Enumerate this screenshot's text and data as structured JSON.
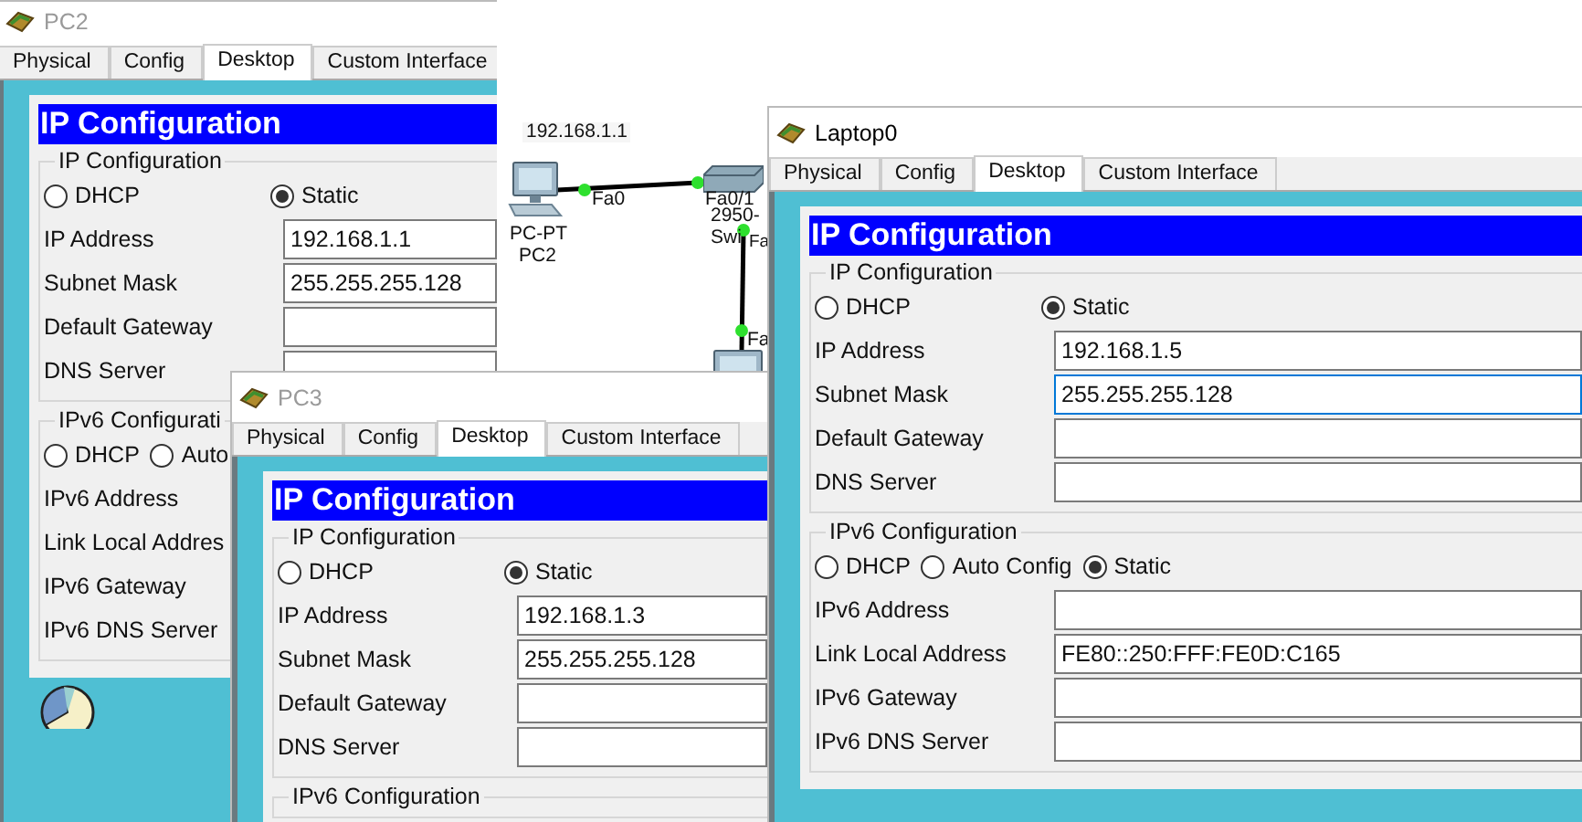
{
  "canvas": {
    "address_note": "192.168.1.1",
    "devices": [
      {
        "kind": "pc",
        "model": "PC-PT",
        "name": "PC2"
      },
      {
        "kind": "switch",
        "model": "2950-",
        "name": "Swi"
      },
      {
        "kind": "pc"
      }
    ],
    "port_labels": [
      "Fa0",
      "Fa0/1",
      "Fa",
      "Fa"
    ]
  },
  "windows": [
    {
      "title": "PC2",
      "active": false,
      "tabs": [
        {
          "label": "Physical",
          "selected": false
        },
        {
          "label": "Config",
          "selected": false
        },
        {
          "label": "Desktop",
          "selected": true
        },
        {
          "label": "Custom Interface",
          "selected": false
        }
      ],
      "heading": "IP Configuration",
      "ipv4": {
        "legend": "IP Configuration",
        "modes": [
          {
            "label": "DHCP",
            "selected": false
          },
          {
            "label": "Static",
            "selected": true
          }
        ],
        "fields": [
          {
            "label": "IP Address",
            "value": "192.168.1.1",
            "focused": false
          },
          {
            "label": "Subnet Mask",
            "value": "255.255.255.128",
            "focused": false
          },
          {
            "label": "Default Gateway",
            "focused": false
          },
          {
            "label": "DNS Server",
            "focused": false
          }
        ]
      },
      "ipv6": {
        "legend": "IPv6 Configurati",
        "modes": [
          {
            "label": "DHCP",
            "selected": false
          },
          {
            "label": "Auto",
            "selected": false
          }
        ],
        "fields": [
          {
            "label": "IPv6 Address"
          },
          {
            "label": "Link Local Addres"
          },
          {
            "label": "IPv6 Gateway"
          },
          {
            "label": "IPv6 DNS Server"
          }
        ]
      }
    },
    {
      "title": "PC3",
      "active": false,
      "tabs": [
        {
          "label": "Physical",
          "selected": false
        },
        {
          "label": "Config",
          "selected": false
        },
        {
          "label": "Desktop",
          "selected": true
        },
        {
          "label": "Custom Interface",
          "selected": false
        }
      ],
      "heading": "IP Configuration",
      "ipv4": {
        "legend": "IP Configuration",
        "modes": [
          {
            "label": "DHCP",
            "selected": false
          },
          {
            "label": "Static",
            "selected": true
          }
        ],
        "fields": [
          {
            "label": "IP Address",
            "value": "192.168.1.3",
            "focused": false
          },
          {
            "label": "Subnet Mask",
            "value": "255.255.255.128",
            "focused": false
          },
          {
            "label": "Default Gateway",
            "focused": false
          },
          {
            "label": "DNS Server",
            "focused": false
          }
        ]
      },
      "ipv6": {
        "legend": "IPv6 Configuration"
      }
    },
    {
      "title": "Laptop0",
      "active": true,
      "tabs": [
        {
          "label": "Physical",
          "selected": false
        },
        {
          "label": "Config",
          "selected": false
        },
        {
          "label": "Desktop",
          "selected": true
        },
        {
          "label": "Custom Interface",
          "selected": false
        }
      ],
      "heading": "IP Configuration",
      "ipv4": {
        "legend": "IP Configuration",
        "modes": [
          {
            "label": "DHCP",
            "selected": false
          },
          {
            "label": "Static",
            "selected": true
          }
        ],
        "fields": [
          {
            "label": "IP Address",
            "value": "192.168.1.5",
            "focused": false
          },
          {
            "label": "Subnet Mask",
            "value": "255.255.255.128",
            "focused": true
          },
          {
            "label": "Default Gateway",
            "focused": false
          },
          {
            "label": "DNS Server",
            "focused": false
          }
        ]
      },
      "ipv6": {
        "legend": "IPv6 Configuration",
        "modes": [
          {
            "label": "DHCP",
            "selected": false
          },
          {
            "label": "Auto Config",
            "selected": false
          },
          {
            "label": "Static",
            "selected": true
          }
        ],
        "fields": [
          {
            "label": "IPv6 Address",
            "focused": false
          },
          {
            "label": "Link Local Address",
            "value": "FE80::250:FFF:FE0D:C165",
            "focused": false
          },
          {
            "label": "IPv6 Gateway",
            "focused": false
          },
          {
            "label": "IPv6 DNS Server",
            "focused": false
          }
        ]
      }
    }
  ]
}
